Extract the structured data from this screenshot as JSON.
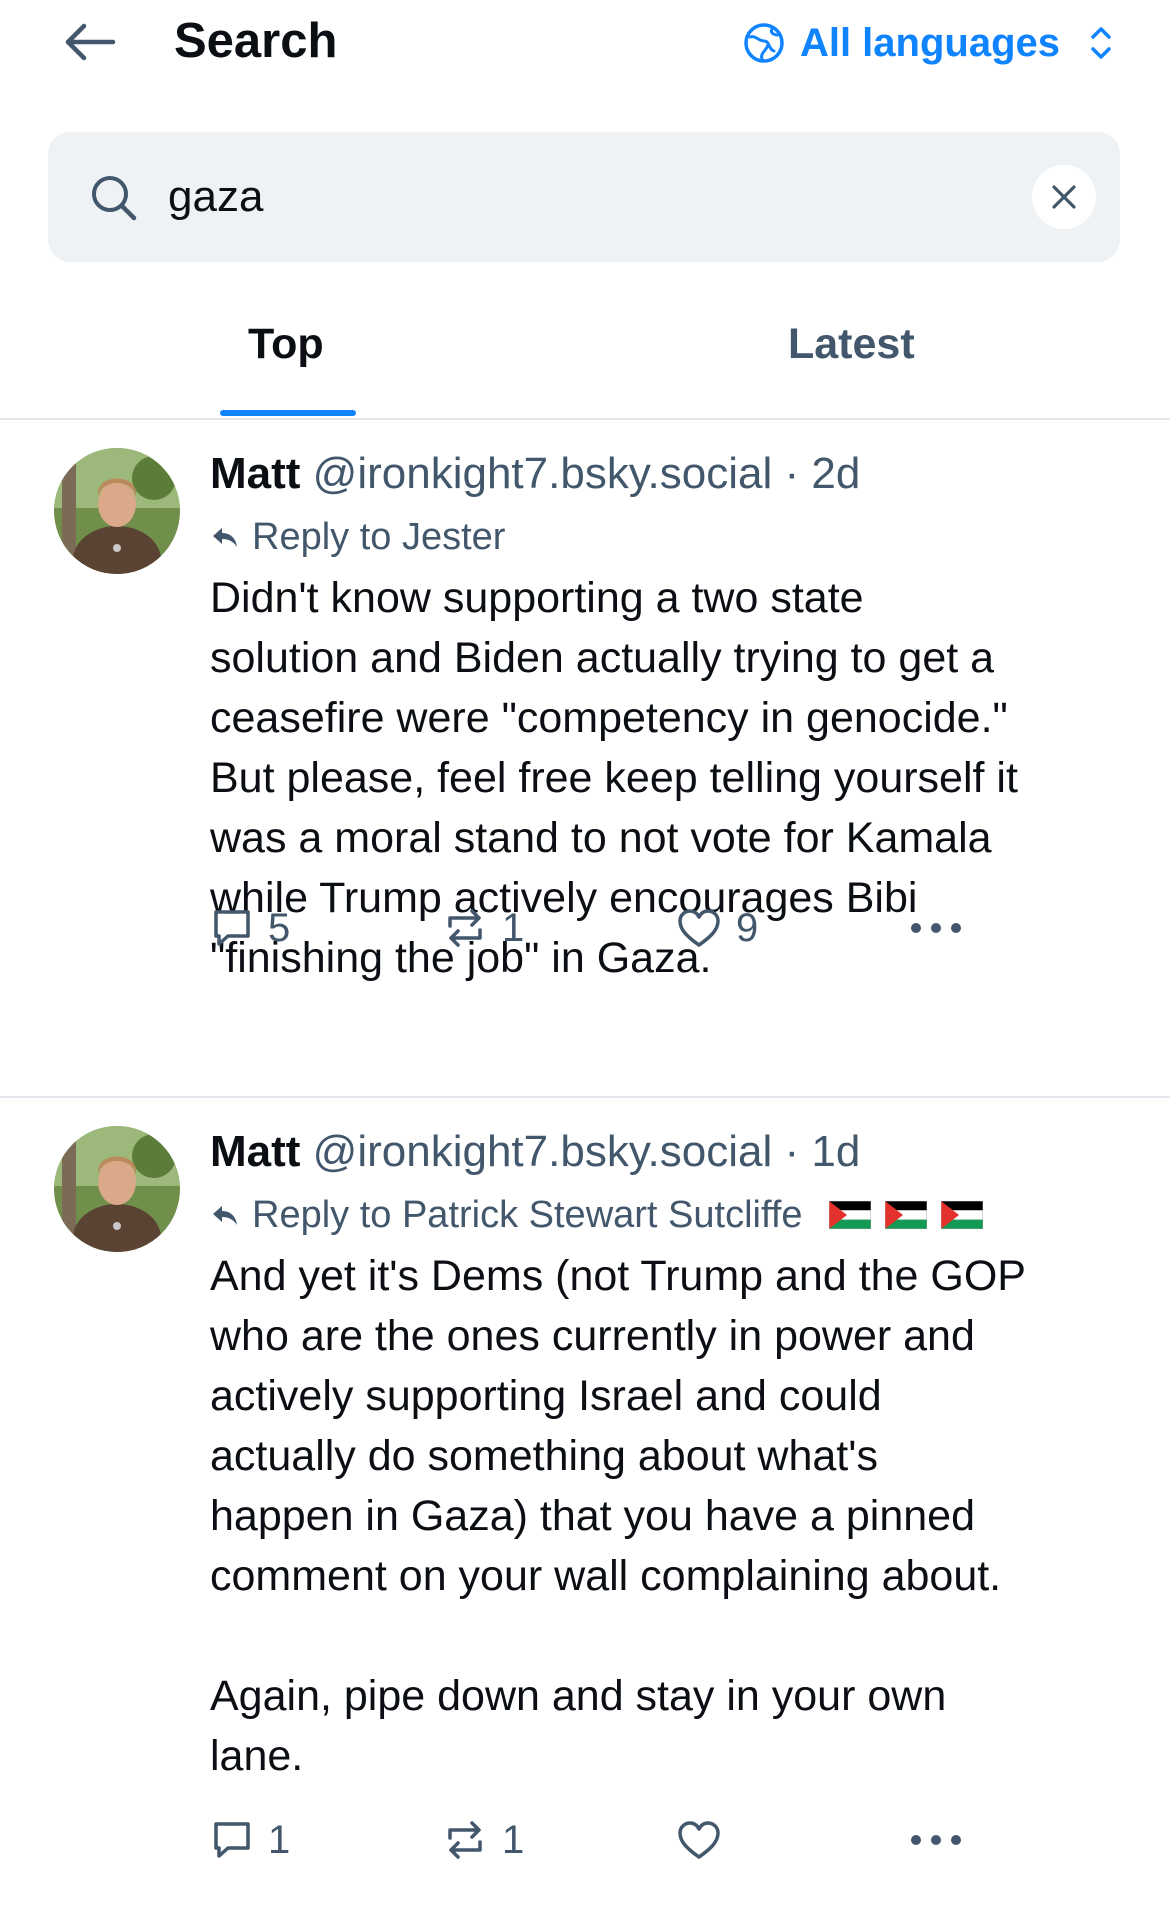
{
  "header": {
    "title": "Search",
    "language_label": "All languages"
  },
  "search": {
    "value": "gaza",
    "placeholder": ""
  },
  "tabs": [
    {
      "label": "Top",
      "active": true
    },
    {
      "label": "Latest",
      "active": false
    }
  ],
  "colors": {
    "accent": "#1083fe",
    "muted": "#42576c",
    "text": "#0b0f14",
    "search_bg": "#eef2f5",
    "divider": "#e2e7ee"
  },
  "posts": [
    {
      "author": "Matt",
      "handle": "@ironkight7.bsky.social",
      "separator": "·",
      "time": "2d",
      "reply_to": "Reply to Jester",
      "text": "Didn't know supporting a two state\nsolution and Biden actually trying to get a\nceasefire were \"competency in genocide.\"\nBut please, feel free keep telling yourself it\nwas a moral stand to not vote for Kamala\nwhile Trump actively encourages Bibi\n\"finishing the job\" in Gaza.",
      "replies": "5",
      "reposts": "1",
      "likes": "9"
    },
    {
      "author": "Matt",
      "handle": "@ironkight7.bsky.social",
      "separator": "·",
      "time": "1d",
      "reply_to": "Reply to Patrick Stewart Sutcliffe",
      "reply_to_flags": [
        "palestine-flag",
        "palestine-flag",
        "palestine-flag"
      ],
      "text": "And yet it's Dems (not Trump and the GOP\nwho are the ones currently in power and\nactively supporting Israel and could\nactually do something about what's\nhappen in Gaza) that you have a pinned\ncomment on your wall complaining about.\n\nAgain, pipe down and stay in your own\nlane.",
      "replies": "1",
      "reposts": "1",
      "likes": ""
    }
  ],
  "icons": {
    "back": "arrow-left-icon",
    "language": "globe-icon",
    "language_toggle": "chevron-up-down-icon",
    "search": "search-icon",
    "clear": "close-icon",
    "reply_indicator": "reply-arrow-icon",
    "reply": "speech-bubble-icon",
    "repost": "repost-icon",
    "like": "heart-icon",
    "more": "ellipsis-icon"
  }
}
